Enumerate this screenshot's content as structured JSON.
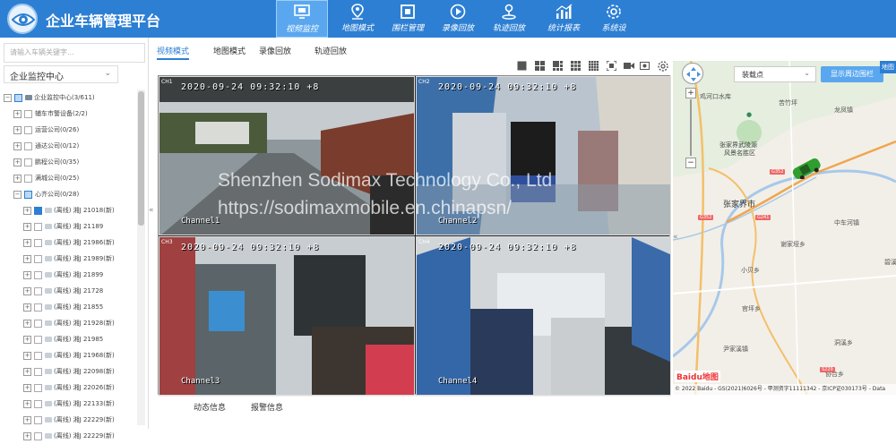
{
  "app": {
    "title": "企业车辆管理平台"
  },
  "nav": [
    {
      "label": "视频监控",
      "icon": "monitor-icon",
      "active": true
    },
    {
      "label": "地图模式",
      "icon": "map-pin-icon",
      "active": false
    },
    {
      "label": "围栏管理",
      "icon": "fence-icon",
      "active": false
    },
    {
      "label": "录像回放",
      "icon": "play-icon",
      "active": false
    },
    {
      "label": "轨迹回放",
      "icon": "track-icon",
      "active": false
    },
    {
      "label": "统计报表",
      "icon": "chart-icon",
      "active": false
    },
    {
      "label": "系统设",
      "icon": "gear-icon",
      "active": false
    }
  ],
  "left": {
    "search_placeholder": "请输入车辆关键字...",
    "select_value": "企业监控中心",
    "tree": [
      {
        "label": "企业监控中心(3/611)",
        "level": 0,
        "expander": "−",
        "check": "half"
      },
      {
        "label": "辅车市警设备(2/2)",
        "level": 1,
        "expander": "+",
        "check": "off"
      },
      {
        "label": "运营公司(0/26)",
        "level": 1,
        "expander": "+",
        "check": "off"
      },
      {
        "label": "通达公司(0/12)",
        "level": 1,
        "expander": "+",
        "check": "off"
      },
      {
        "label": "鹏程公司(0/35)",
        "level": 1,
        "expander": "+",
        "check": "off"
      },
      {
        "label": "满城公司(0/25)",
        "level": 1,
        "expander": "+",
        "check": "off"
      },
      {
        "label": "心齐公司(0/28)",
        "level": 1,
        "expander": "−",
        "check": "half"
      },
      {
        "label": "(离线) 湘J 21018(新)",
        "level": 2,
        "expander": "+",
        "check": "on"
      },
      {
        "label": "(离线) 湘J 21189",
        "level": 2,
        "expander": "+",
        "check": "off"
      },
      {
        "label": "(离线) 湘J 21986(新)",
        "level": 2,
        "expander": "+",
        "check": "off"
      },
      {
        "label": "(离线) 湘J 21989(新)",
        "level": 2,
        "expander": "+",
        "check": "off"
      },
      {
        "label": "(离线) 湘J 21899",
        "level": 2,
        "expander": "+",
        "check": "off"
      },
      {
        "label": "(离线) 湘J 21728",
        "level": 2,
        "expander": "+",
        "check": "off"
      },
      {
        "label": "(离线) 湘J 21855",
        "level": 2,
        "expander": "+",
        "check": "off"
      },
      {
        "label": "(离线) 湘J 21928(新)",
        "level": 2,
        "expander": "+",
        "check": "off"
      },
      {
        "label": "(离线) 湘J 21985",
        "level": 2,
        "expander": "+",
        "check": "off"
      },
      {
        "label": "(离线) 湘J 21968(新)",
        "level": 2,
        "expander": "+",
        "check": "off"
      },
      {
        "label": "(离线) 湘J 22098(新)",
        "level": 2,
        "expander": "+",
        "check": "off"
      },
      {
        "label": "(离线) 湘J 22026(新)",
        "level": 2,
        "expander": "+",
        "check": "off"
      },
      {
        "label": "(离线) 湘J 22133(新)",
        "level": 2,
        "expander": "+",
        "check": "off"
      },
      {
        "label": "(离线) 湘J 22229(新)",
        "level": 2,
        "expander": "+",
        "check": "off"
      },
      {
        "label": "(离线) 湘J 22229(新)",
        "level": 2,
        "expander": "+",
        "check": "off"
      }
    ]
  },
  "tabs": [
    "视频模式",
    "地图模式",
    "录像回放",
    "轨迹回放"
  ],
  "toolbar": [
    "layout-1x1-icon",
    "layout-2x2-icon",
    "layout-1plus5-icon",
    "layout-3x3-icon",
    "layout-4x4-icon",
    "fullscreen-icon",
    "record-icon",
    "snapshot-icon",
    "settings-icon"
  ],
  "video": {
    "channels": [
      {
        "id": "CH1",
        "timestamp": "2020-09-24  09:32:10  +8",
        "name": "Channel1"
      },
      {
        "id": "CH2",
        "timestamp": "2020-09-24  09:32:10  +8",
        "name": "Channel2"
      },
      {
        "id": "CH3",
        "timestamp": "2020-09-24  09:32:10  +8",
        "name": "Channel3"
      },
      {
        "id": "CH4",
        "timestamp": "2020-09-24  09:32:10  +8",
        "name": "Channel4"
      }
    ],
    "watermark_line1": "Shenzhen Sodimax Technology Co., Ltd",
    "watermark_line2": "https://sodimaxmobile.en.chinapsn/"
  },
  "bottom_tabs": [
    "动态信息",
    "报警信息"
  ],
  "map": {
    "poi_select": "装载点",
    "surround_button": "显示周边围栏",
    "map_type": "地图",
    "city": "张家界市",
    "park": "张家界武陵源",
    "park2": "风景名胜区",
    "labels": [
      "中车河镇",
      "谢家垭乡",
      "小贝乡",
      "碧溪乡",
      "官坪乡",
      "尹家溪镇",
      "洞溪乡",
      "协合乡",
      "龙凤镇",
      "鸡河口水库",
      "苦竹坪"
    ],
    "roads": [
      "G352",
      "G352",
      "G241",
      "S229"
    ],
    "baidu": "Baidu地图",
    "copyright": "© 2022 Baidu - GS(2021)6026号 - 甲测资字11111342 - 京ICP证030173号 - Data"
  },
  "colors": {
    "primary": "#2d7fd3",
    "nav_active": "#5aa7ef"
  }
}
